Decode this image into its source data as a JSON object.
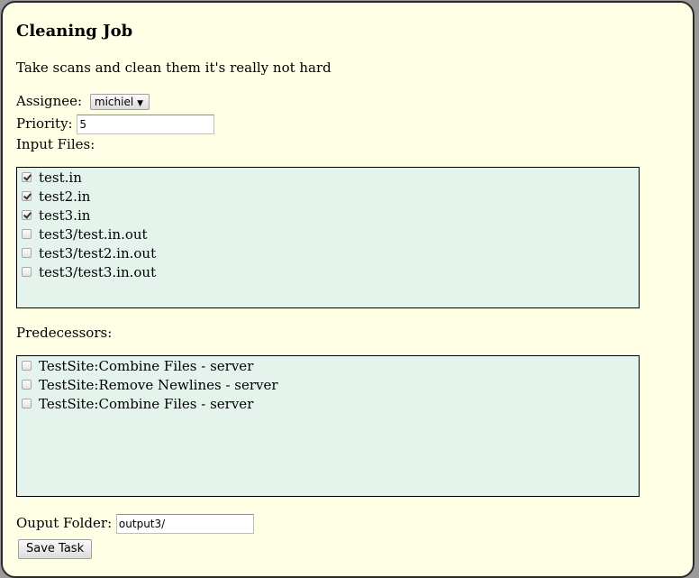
{
  "job": {
    "title": "Cleaning Job",
    "description": "Take scans and clean them it's really not hard"
  },
  "assignee": {
    "label": "Assignee:",
    "selected": "michiel",
    "caret_icon": "triangle-down-icon"
  },
  "priority": {
    "label": "Priority:",
    "value": "5"
  },
  "input_files": {
    "label": "Input Files:",
    "items": [
      {
        "label": "test.in",
        "checked": true
      },
      {
        "label": "test2.in",
        "checked": true
      },
      {
        "label": "test3.in",
        "checked": true
      },
      {
        "label": "test3/test.in.out",
        "checked": false
      },
      {
        "label": "test3/test2.in.out",
        "checked": false
      },
      {
        "label": "test3/test3.in.out",
        "checked": false
      }
    ]
  },
  "predecessors": {
    "label": "Predecessors:",
    "items": [
      {
        "label": "TestSite:Combine Files - server",
        "checked": false
      },
      {
        "label": "TestSite:Remove Newlines - server",
        "checked": false
      },
      {
        "label": "TestSite:Combine Files - server",
        "checked": false
      }
    ]
  },
  "output_folder": {
    "label": "Ouput Folder:",
    "value": "output3/"
  },
  "save_label": "Save Task",
  "colors": {
    "panel_bg": "#ffffe6",
    "list_bg": "#e4f4ec",
    "border": "#2a2a2a"
  }
}
